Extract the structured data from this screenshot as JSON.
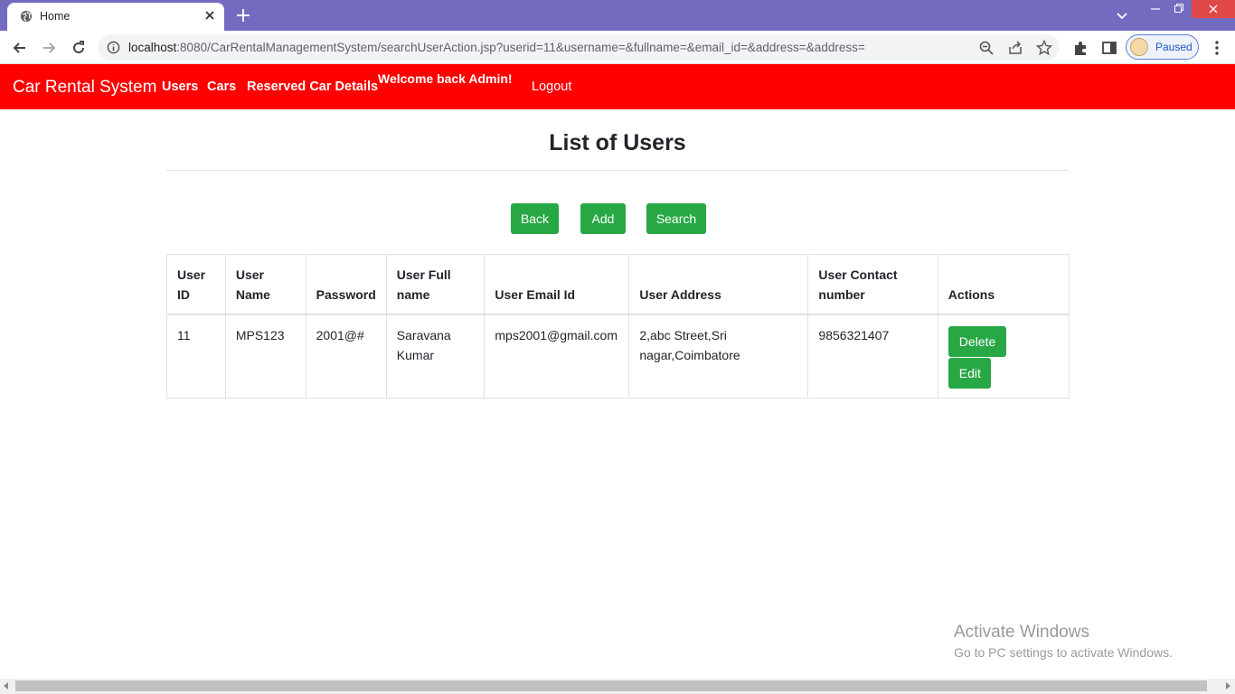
{
  "browser": {
    "tab_title": "Home",
    "url_host": "localhost",
    "url_rest": ":8080/CarRentalManagementSystem/searchUserAction.jsp?userid=11&username=&fullname=&email_id=&address=&address=",
    "profile_label": "Paused"
  },
  "navbar": {
    "brand": "Car Rental System",
    "links": [
      "Users",
      "Cars",
      "Reserved Car Details"
    ],
    "welcome": "Welcome back Admin!",
    "logout": "Logout",
    "color": "#ff0000"
  },
  "main": {
    "title": "List of Users",
    "buttons": {
      "back": "Back",
      "add": "Add",
      "search": "Search"
    },
    "accent_color": "#28a745"
  },
  "table": {
    "headers": [
      "User ID",
      "User Name",
      "Password",
      "User Full name",
      "User Email Id",
      "User Address",
      "User Contact number",
      "Actions"
    ],
    "rows": [
      {
        "user_id": "11",
        "user_name": "MPS123",
        "password": "2001@#",
        "full_name": "Saravana Kumar",
        "email": "mps2001@gmail.com",
        "address": "2,abc Street,Sri nagar,Coimbatore",
        "contact": "9856321407",
        "delete_label": "Delete",
        "edit_label": "Edit"
      }
    ]
  },
  "watermark": {
    "line1": "Activate Windows",
    "line2": "Go to PC settings to activate Windows."
  }
}
